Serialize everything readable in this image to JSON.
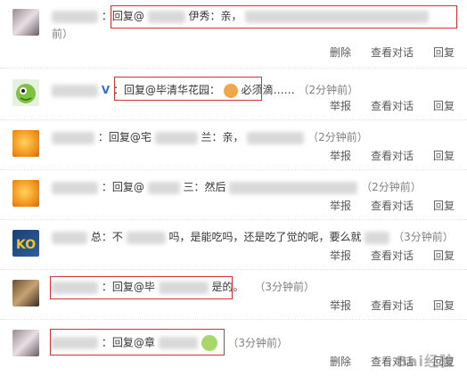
{
  "comments": [
    {
      "line1": "：回复@",
      "visible2": "伊秀：亲，",
      "line2": "前）"
    },
    {
      "vip": "V",
      "text": "：回复@毕清华花园：",
      "suffix": "必须滴……",
      "time": "（2分钟前）"
    },
    {
      "text": "：回复@宅",
      "mid": "兰：亲，",
      "time": "（2分钟前）"
    },
    {
      "text": "：回复@",
      "mid": "三：然后",
      "time": "（2分钟前）"
    },
    {
      "text": "总：不",
      "mid": "吗，是能吃吗，还是吃了觉的呢，要么就",
      "time": "（3分钟前）"
    },
    {
      "text": "：回复@毕",
      "mid": "是的。",
      "time": "（3分钟前）"
    },
    {
      "text": "：回复@章",
      "time": "（3分钟前）"
    }
  ],
  "actions": {
    "delete": "删除",
    "report": "举报",
    "view": "查看对话",
    "reply": "回复"
  },
  "watermark": "Bai经验"
}
